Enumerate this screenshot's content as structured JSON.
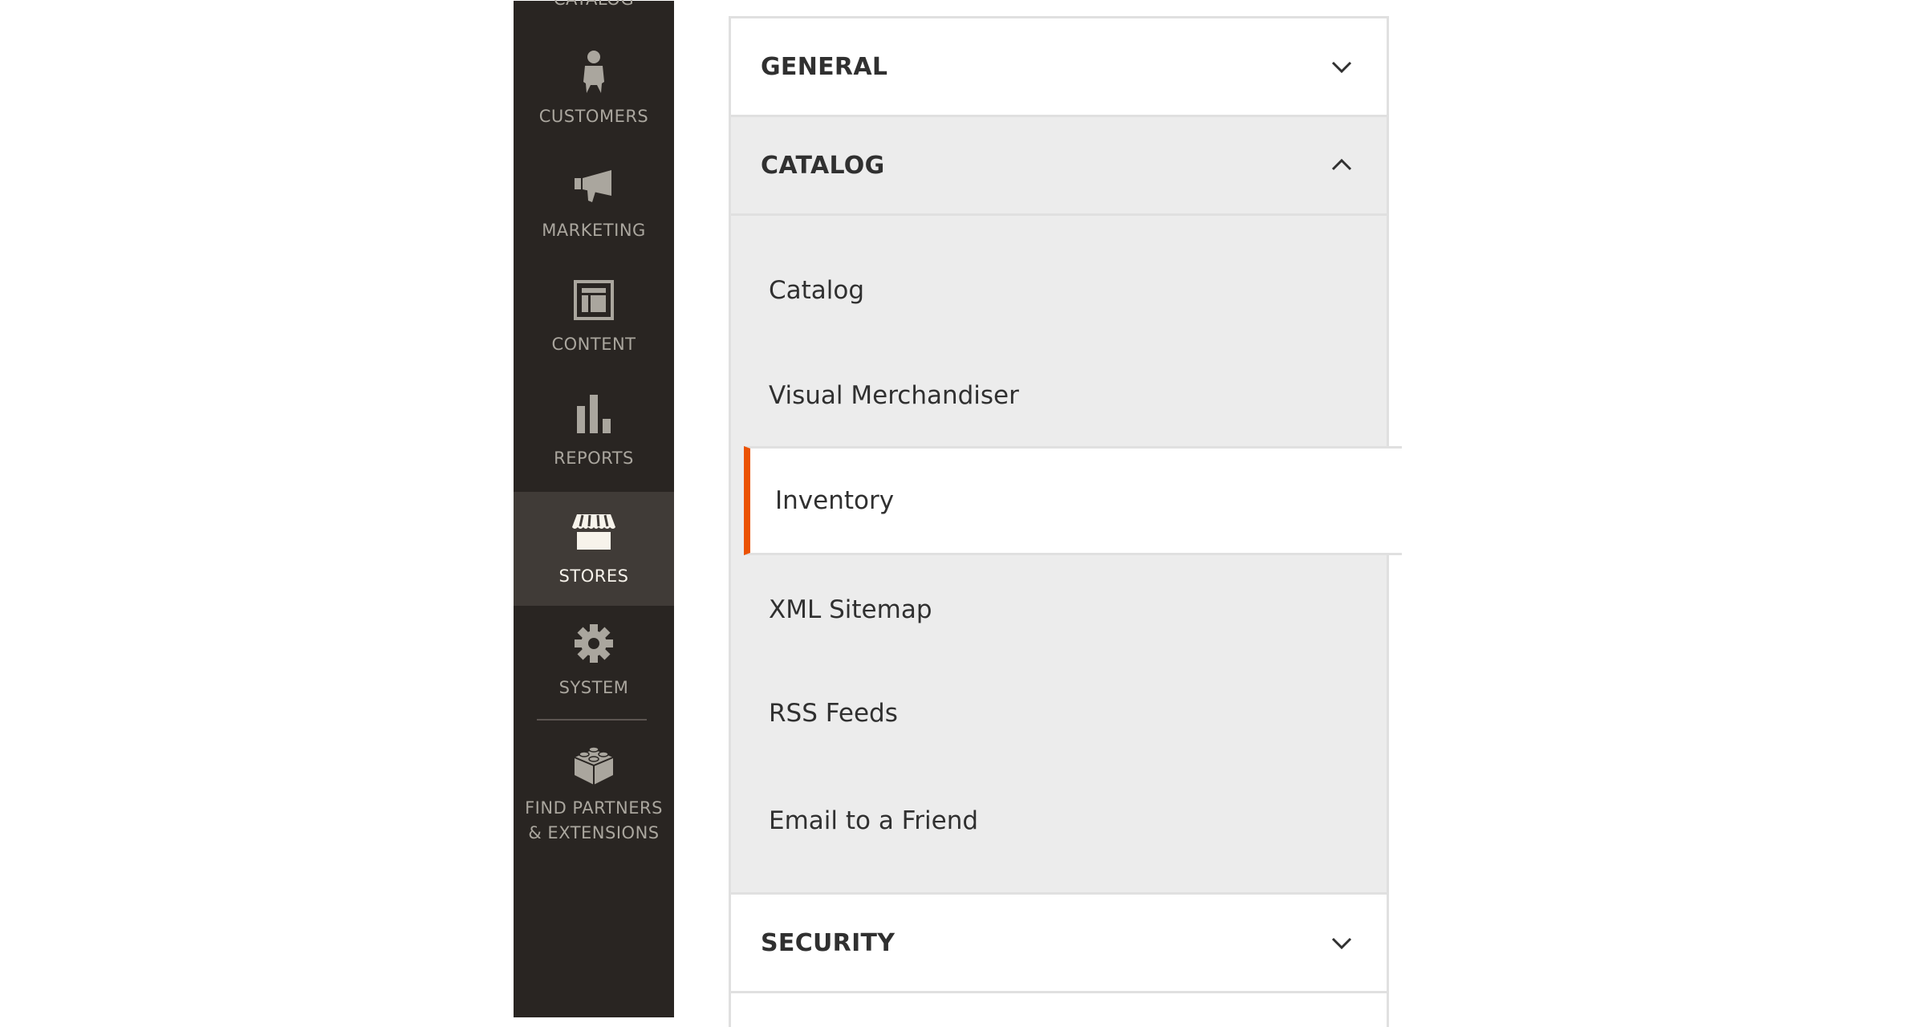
{
  "sidebar": {
    "partial_top_label": "CATALOG",
    "items": [
      {
        "label": "CUSTOMERS",
        "icon": "customer-icon",
        "active": false
      },
      {
        "label": "MARKETING",
        "icon": "megaphone-icon",
        "active": false
      },
      {
        "label": "CONTENT",
        "icon": "content-layout-icon",
        "active": false
      },
      {
        "label": "REPORTS",
        "icon": "bar-chart-icon",
        "active": false
      },
      {
        "label": "STORES",
        "icon": "storefront-icon",
        "active": true
      },
      {
        "label": "SYSTEM",
        "icon": "gear-icon",
        "active": false
      }
    ],
    "partners": {
      "line1": "FIND PARTNERS",
      "line2": "& EXTENSIONS",
      "icon": "lego-brick-icon"
    }
  },
  "config_nav": {
    "sections": [
      {
        "title": "GENERAL",
        "expanded": false
      },
      {
        "title": "CATALOG",
        "expanded": true,
        "items": [
          {
            "label": "Catalog",
            "active": false
          },
          {
            "label": "Visual Merchandiser",
            "active": false
          },
          {
            "label": "Inventory",
            "active": true
          },
          {
            "label": "XML Sitemap",
            "active": false
          },
          {
            "label": "RSS Feeds",
            "active": false
          },
          {
            "label": "Email to a Friend",
            "active": false
          }
        ]
      },
      {
        "title": "SECURITY",
        "expanded": false
      }
    ]
  },
  "colors": {
    "sidebar_bg": "#292522",
    "sidebar_active_bg": "#403b37",
    "sidebar_text": "#aaa69e",
    "sidebar_active_text": "#f7f3eb",
    "accent": "#eb5202",
    "submenu_bg": "#ececec"
  }
}
